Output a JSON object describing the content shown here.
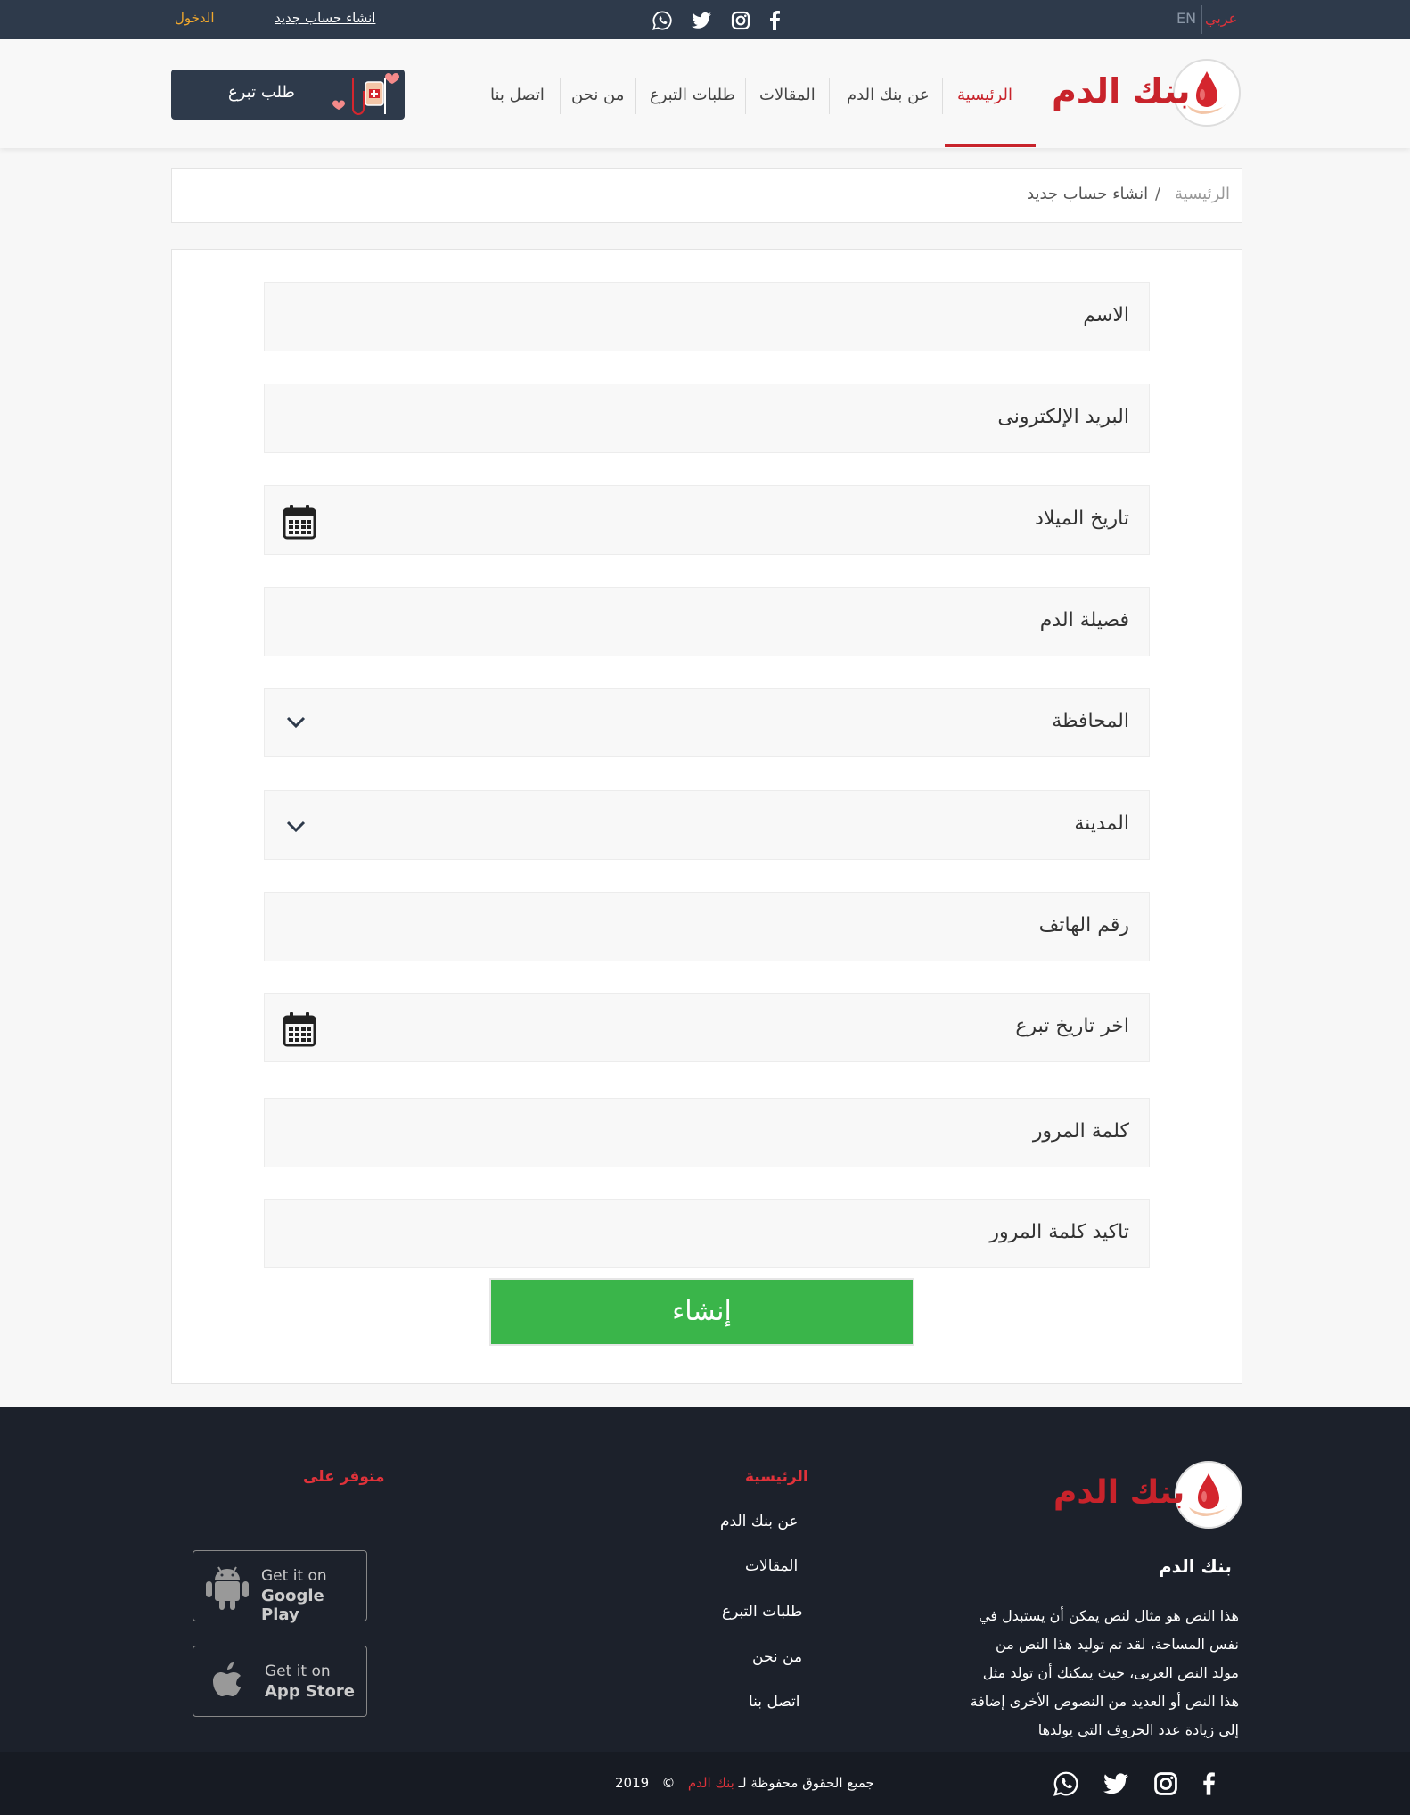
{
  "topbar": {
    "lang_ar": "عربي",
    "lang_en": "EN",
    "register": "انشاء حساب جديد",
    "login": "الدخول"
  },
  "header": {
    "brand": "بنك الدم",
    "nav": {
      "home": "الرئيسية",
      "about_bank": "عن بنك الدم",
      "articles": "المقالات",
      "donation_requests": "طلبات التبرع",
      "about_us": "من نحن",
      "contact": "اتصل بنا"
    },
    "donate_button": "طلب تبرع"
  },
  "breadcrumb": {
    "home": "الرئيسية",
    "separator": "/",
    "current": "انشاء حساب جديد"
  },
  "form": {
    "name": "الاسم",
    "email": "البريد الإلكترونى",
    "birth_date": "تاريخ الميلاد",
    "blood_type": "فصيلة الدم",
    "governorate": "المحافظة",
    "city": "المدينة",
    "phone": "رقم الهاتف",
    "last_donation": "اخر تاريخ تبرع",
    "password": "كلمة المرور",
    "password_confirm": "تاكيد كلمة المرور",
    "submit": "إنشاء"
  },
  "footer": {
    "brand": "بنك الدم",
    "title": "بنك الدم",
    "about_text": "هذا النص هو مثال لنص يمكن أن يستبدل في نفس المساحة، لقد تم توليد هذا النص من مولد النص العربى، حيث يمكنك أن تولد مثل هذا النص أو العديد من النصوص الأخرى إضافة إلى زيادة عدد الحروف التى يولدها",
    "links_head": "الرئيسية",
    "links": [
      "عن بنك الدم",
      "المقالات",
      "طلبات التبرع",
      "من نحن",
      "اتصل بنا"
    ],
    "available_head": "متوفر على",
    "google_small": "Get it on",
    "google_big": "Google Play",
    "apple_small": "Get it on",
    "apple_big": "App Store",
    "copyright_pre": "جميع الحقوق محفوظة لـ",
    "copyright_brand": "بنك الدم",
    "copyright_symbol": "©",
    "copyright_year": "2019"
  },
  "colors": {
    "brand_red": "#c8232b",
    "dark_navy": "#2e3a4b",
    "submit_green": "#3ab54a",
    "footer_bg": "#1c212b"
  },
  "icons": [
    "facebook-icon",
    "instagram-icon",
    "twitter-icon",
    "whatsapp-icon",
    "calendar-icon",
    "chevron-down-icon",
    "android-icon",
    "apple-icon",
    "blood-drop-icon"
  ]
}
